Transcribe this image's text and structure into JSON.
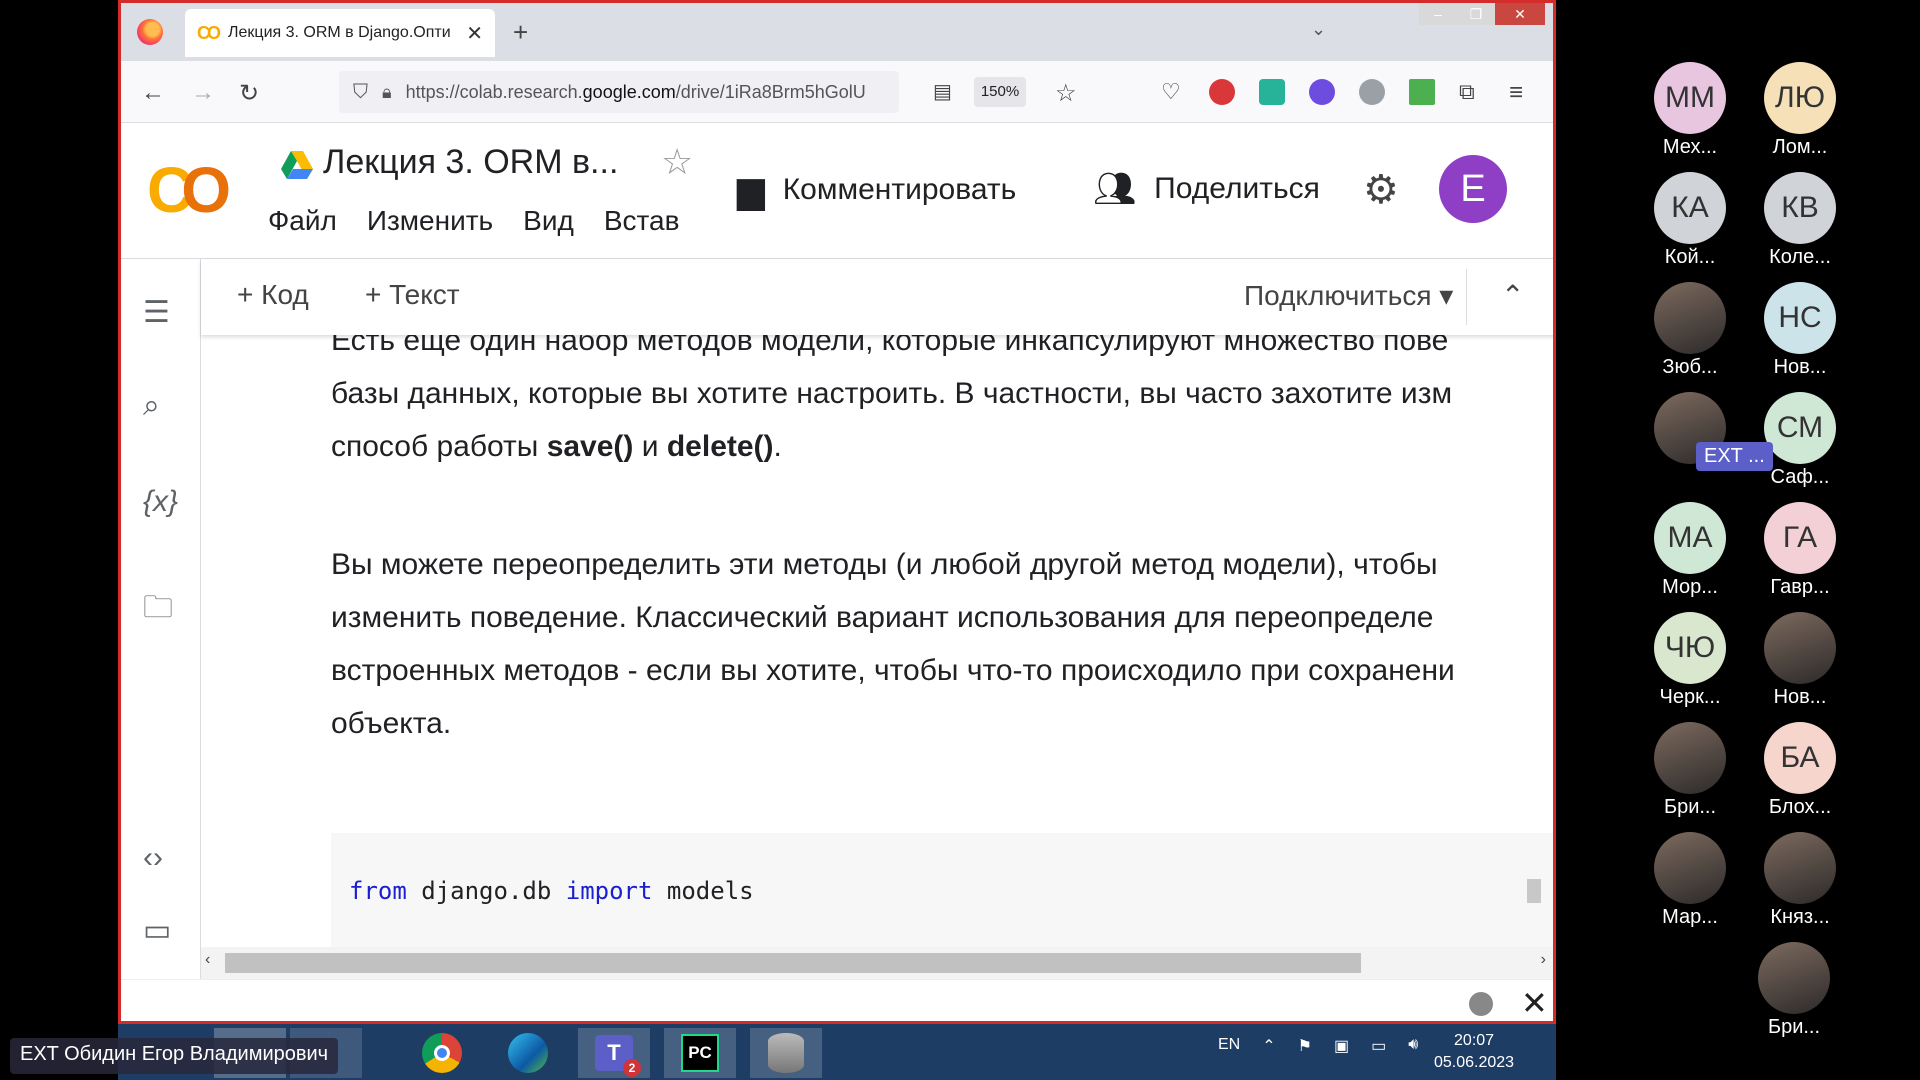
{
  "browser": {
    "tab_title": "Лекция 3. ORM в Django.Опти",
    "url_prefix": "https://colab.research.",
    "url_domain": "google.com",
    "url_suffix": "/drive/1iRa8Brm5hGolU",
    "zoom": "150%"
  },
  "colab": {
    "logo": "CO",
    "title": "Лекция 3. ORM в...",
    "menu": [
      "Файл",
      "Изменить",
      "Вид",
      "Встав"
    ],
    "comment_label": "Комментировать",
    "share_label": "Поделиться",
    "avatar_letter": "E",
    "add_code": "+ Код",
    "add_text": "+ Текст",
    "connect": "Подключиться"
  },
  "cell": {
    "p1": [
      "Есть еще один набор методов модели, которые инкапсулируют множество пове",
      "базы данных, которые вы хотите настроить. В частности, вы часто захотите изм"
    ],
    "p1_line3_prefix": "способ работы ",
    "p1_save": "save()",
    "p1_and": " и ",
    "p1_delete": "delete()",
    "p1_end": ".",
    "p2": [
      "Вы можете переопределить эти методы (и любой другой метод модели), чтобы",
      "изменить поведение. Классический вариант использования для переопределе",
      "встроенных методов - если вы хотите, чтобы что-то происходило при сохранени",
      "объекта."
    ],
    "code": {
      "kw1": "from",
      "mod": " django.db ",
      "kw2": "import",
      "name": " models"
    }
  },
  "taskbar": {
    "lang": "EN",
    "time": "20:07",
    "date": "05.06.2023",
    "speaker_name": "EXT Обидин Егор Владимирович",
    "teams_badge": "2"
  },
  "participants": [
    {
      "initials": "ММ",
      "name": "Мех...",
      "color": "#e8c6e0"
    },
    {
      "initials": "ЛЮ",
      "name": "Лом...",
      "color": "#f6e0b8"
    },
    {
      "initials": "КА",
      "name": "Кой...",
      "color": "#d0d3d8"
    },
    {
      "initials": "КВ",
      "name": "Коле...",
      "color": "#d0d3d8"
    },
    {
      "initials": "",
      "name": "Зюб...",
      "color": "photo"
    },
    {
      "initials": "НС",
      "name": "Нов...",
      "color": "#cde3ea"
    },
    {
      "initials": "",
      "name": "EXT ...",
      "color": "photo"
    },
    {
      "initials": "СМ",
      "name": "Саф...",
      "color": "#cfe8d5"
    },
    {
      "initials": "МА",
      "name": "Мор...",
      "color": "#cfe8d5"
    },
    {
      "initials": "ГА",
      "name": "Гавр...",
      "color": "#f3d0d6"
    },
    {
      "initials": "ЧЮ",
      "name": "Черк...",
      "color": "#d9e7cf"
    },
    {
      "initials": "",
      "name": "Нов...",
      "color": "photo"
    },
    {
      "initials": "",
      "name": "Бри...",
      "color": "photo"
    },
    {
      "initials": "БА",
      "name": "Блох...",
      "color": "#f6d6cc"
    },
    {
      "initials": "",
      "name": "Мар...",
      "color": "photo"
    },
    {
      "initials": "",
      "name": "Княз...",
      "color": "photo"
    },
    {
      "initials": "",
      "name": "Бри...",
      "color": "photo"
    }
  ]
}
